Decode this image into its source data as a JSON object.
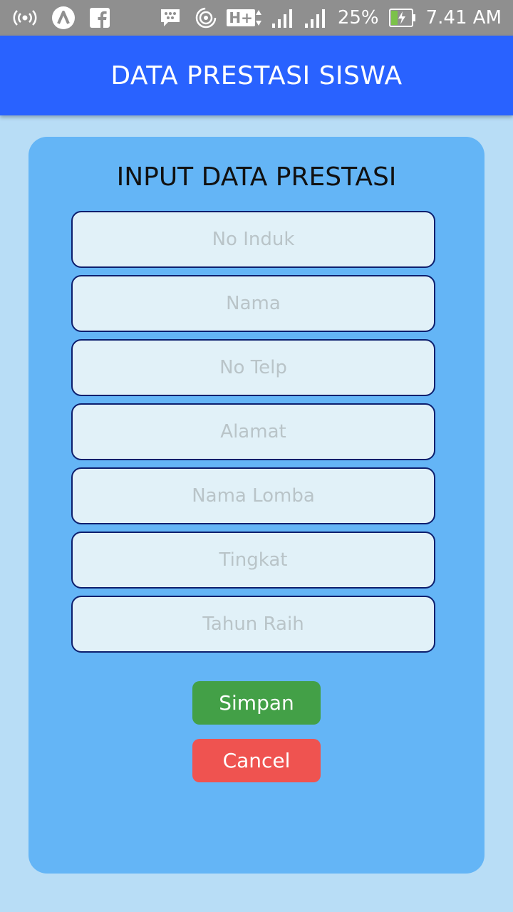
{
  "status_bar": {
    "icons": [
      "broadcast-icon",
      "app-a-icon",
      "facebook-icon",
      "bbm-icon",
      "hotspot-icon",
      "hplus-icon",
      "signal-icon",
      "signal-icon",
      "battery-charging-icon"
    ],
    "hplus_label": "H+",
    "battery": "25%",
    "time": "7.41 AM"
  },
  "app_bar": {
    "title": "DATA PRESTASI SISWA",
    "color": "#2962ff"
  },
  "form": {
    "title": "INPUT DATA PRESTASI",
    "fields": [
      {
        "placeholder": "No Induk",
        "value": ""
      },
      {
        "placeholder": "Nama",
        "value": ""
      },
      {
        "placeholder": "No Telp",
        "value": ""
      },
      {
        "placeholder": "Alamat",
        "value": ""
      },
      {
        "placeholder": "Nama Lomba",
        "value": ""
      },
      {
        "placeholder": "Tingkat",
        "value": ""
      },
      {
        "placeholder": "Tahun Raih",
        "value": ""
      }
    ],
    "save_label": "Simpan",
    "cancel_label": "Cancel",
    "save_color": "#43a047",
    "cancel_color": "#ef5350"
  }
}
